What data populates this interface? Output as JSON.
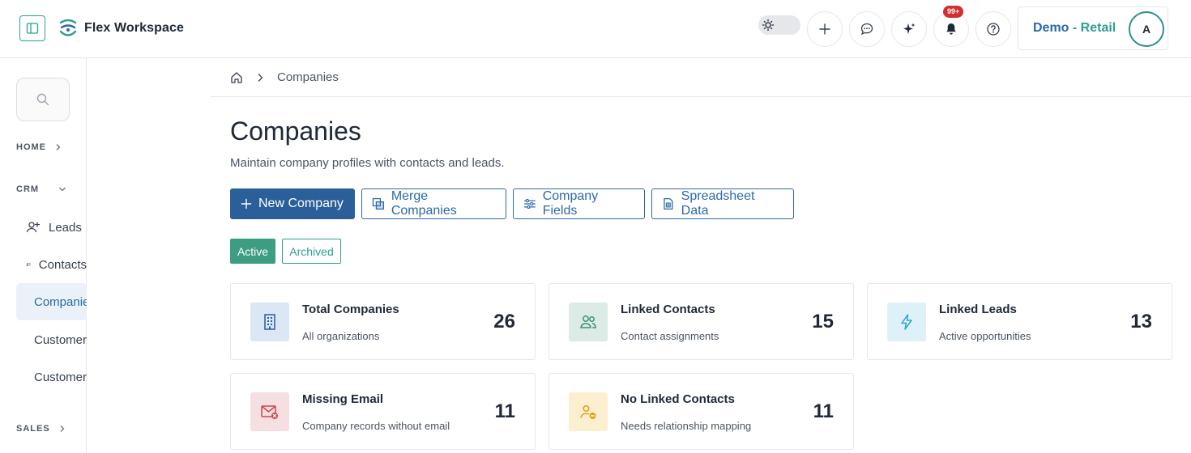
{
  "app": {
    "name": "Flex Workspace"
  },
  "header": {
    "notifications_badge": "99+",
    "workspace": {
      "name": "Demo",
      "separator": " - ",
      "sub": "Retail"
    },
    "avatar_initial": "A"
  },
  "nav": {
    "sections": {
      "home": "HOME",
      "crm": "CRM",
      "sales": "SALES"
    },
    "items": [
      {
        "label": "Leads",
        "icon": "user-plus-icon"
      },
      {
        "label": "Contacts",
        "icon": "contacts-icon"
      },
      {
        "label": "Companies",
        "icon": "bar-chart-icon"
      },
      {
        "label": "Customers",
        "icon": "globe-icon"
      },
      {
        "label": "Customer Documents",
        "icon": "document-icon"
      }
    ]
  },
  "breadcrumb": {
    "current": "Companies"
  },
  "page": {
    "title": "Companies",
    "subtitle": "Maintain company profiles with contacts and leads."
  },
  "actions": {
    "new_company": "New Company",
    "merge_companies": "Merge Companies",
    "company_fields": "Company Fields",
    "spreadsheet_data": "Spreadsheet Data"
  },
  "filters": {
    "active": "Active",
    "archived": "Archived"
  },
  "stats": [
    {
      "title": "Total Companies",
      "sub": "All organizations",
      "value": "26",
      "color": "#dbe7f5"
    },
    {
      "title": "Linked Contacts",
      "sub": "Contact assignments",
      "value": "15",
      "color": "#dcebe6"
    },
    {
      "title": "Linked Leads",
      "sub": "Active opportunities",
      "value": "13",
      "color": "#def1f8"
    },
    {
      "title": "Missing Email",
      "sub": "Company records without email",
      "value": "11",
      "color": "#f6dfe1"
    },
    {
      "title": "No Linked Contacts",
      "sub": "Needs relationship mapping",
      "value": "11",
      "color": "#fbefcf"
    }
  ],
  "colors": {
    "primary": "#2b5f9a",
    "accent": "#2e9e8f",
    "badge": "#d32f2f"
  }
}
